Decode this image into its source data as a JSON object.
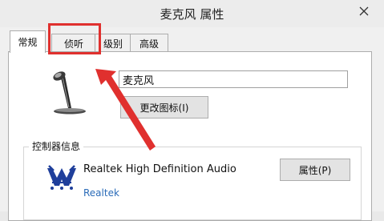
{
  "window": {
    "title": "麦克风 属性"
  },
  "tabs": [
    {
      "label": "常规"
    },
    {
      "label": "侦听"
    },
    {
      "label": "级别"
    },
    {
      "label": "高级"
    }
  ],
  "general": {
    "device_name_value": "麦克风",
    "change_icon_button": "更改图标(I)",
    "controller_group_label": "控制器信息",
    "controller_name": "Realtek High Definition Audio",
    "controller_vendor": "Realtek",
    "properties_button": "属性(P)"
  },
  "colors": {
    "highlight": "#e0302e",
    "link": "#2a6bb8"
  },
  "icons": {
    "close": "close-icon",
    "microphone": "microphone-icon",
    "realtek": "realtek-logo-icon",
    "annotation_arrow": "arrow-annotation"
  }
}
